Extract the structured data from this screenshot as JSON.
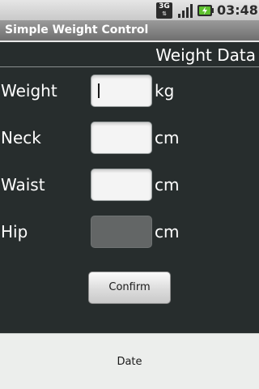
{
  "status_bar": {
    "network_type": "3G",
    "network_icon": "3g-data-icon",
    "signal_icon": "signal-strength-icon",
    "battery_icon": "battery-charging-icon",
    "time": "03:48"
  },
  "app": {
    "title": "Simple Weight Control"
  },
  "form": {
    "heading": "Weight Data",
    "rows": [
      {
        "label": "Weight",
        "value": "",
        "unit": "kg",
        "focused": true,
        "enabled": true
      },
      {
        "label": "Neck",
        "value": "",
        "unit": "cm",
        "enabled": true
      },
      {
        "label": "Waist",
        "value": "",
        "unit": "cm",
        "enabled": true
      },
      {
        "label": "Hip",
        "value": "",
        "unit": "cm",
        "enabled": false
      }
    ],
    "confirm_label": "Confirm"
  },
  "bottom_panel": {
    "label": "Date"
  },
  "colors": {
    "background": "#272d2d",
    "title_bar": "#838383",
    "field_enabled": "#f4f4f4",
    "field_disabled": "#636666",
    "bottom_panel": "#eceeec"
  }
}
